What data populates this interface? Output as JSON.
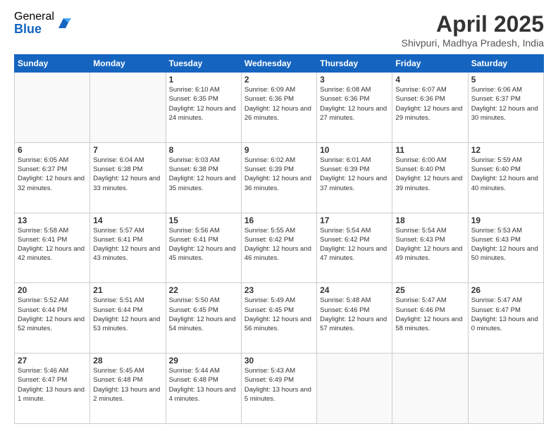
{
  "logo": {
    "general": "General",
    "blue": "Blue"
  },
  "header": {
    "month_year": "April 2025",
    "location": "Shivpuri, Madhya Pradesh, India"
  },
  "weekdays": [
    "Sunday",
    "Monday",
    "Tuesday",
    "Wednesday",
    "Thursday",
    "Friday",
    "Saturday"
  ],
  "weeks": [
    [
      {
        "day": "",
        "empty": true
      },
      {
        "day": "",
        "empty": true
      },
      {
        "day": "1",
        "sunrise": "Sunrise: 6:10 AM",
        "sunset": "Sunset: 6:35 PM",
        "daylight": "Daylight: 12 hours and 24 minutes."
      },
      {
        "day": "2",
        "sunrise": "Sunrise: 6:09 AM",
        "sunset": "Sunset: 6:36 PM",
        "daylight": "Daylight: 12 hours and 26 minutes."
      },
      {
        "day": "3",
        "sunrise": "Sunrise: 6:08 AM",
        "sunset": "Sunset: 6:36 PM",
        "daylight": "Daylight: 12 hours and 27 minutes."
      },
      {
        "day": "4",
        "sunrise": "Sunrise: 6:07 AM",
        "sunset": "Sunset: 6:36 PM",
        "daylight": "Daylight: 12 hours and 29 minutes."
      },
      {
        "day": "5",
        "sunrise": "Sunrise: 6:06 AM",
        "sunset": "Sunset: 6:37 PM",
        "daylight": "Daylight: 12 hours and 30 minutes."
      }
    ],
    [
      {
        "day": "6",
        "sunrise": "Sunrise: 6:05 AM",
        "sunset": "Sunset: 6:37 PM",
        "daylight": "Daylight: 12 hours and 32 minutes."
      },
      {
        "day": "7",
        "sunrise": "Sunrise: 6:04 AM",
        "sunset": "Sunset: 6:38 PM",
        "daylight": "Daylight: 12 hours and 33 minutes."
      },
      {
        "day": "8",
        "sunrise": "Sunrise: 6:03 AM",
        "sunset": "Sunset: 6:38 PM",
        "daylight": "Daylight: 12 hours and 35 minutes."
      },
      {
        "day": "9",
        "sunrise": "Sunrise: 6:02 AM",
        "sunset": "Sunset: 6:39 PM",
        "daylight": "Daylight: 12 hours and 36 minutes."
      },
      {
        "day": "10",
        "sunrise": "Sunrise: 6:01 AM",
        "sunset": "Sunset: 6:39 PM",
        "daylight": "Daylight: 12 hours and 37 minutes."
      },
      {
        "day": "11",
        "sunrise": "Sunrise: 6:00 AM",
        "sunset": "Sunset: 6:40 PM",
        "daylight": "Daylight: 12 hours and 39 minutes."
      },
      {
        "day": "12",
        "sunrise": "Sunrise: 5:59 AM",
        "sunset": "Sunset: 6:40 PM",
        "daylight": "Daylight: 12 hours and 40 minutes."
      }
    ],
    [
      {
        "day": "13",
        "sunrise": "Sunrise: 5:58 AM",
        "sunset": "Sunset: 6:41 PM",
        "daylight": "Daylight: 12 hours and 42 minutes."
      },
      {
        "day": "14",
        "sunrise": "Sunrise: 5:57 AM",
        "sunset": "Sunset: 6:41 PM",
        "daylight": "Daylight: 12 hours and 43 minutes."
      },
      {
        "day": "15",
        "sunrise": "Sunrise: 5:56 AM",
        "sunset": "Sunset: 6:41 PM",
        "daylight": "Daylight: 12 hours and 45 minutes."
      },
      {
        "day": "16",
        "sunrise": "Sunrise: 5:55 AM",
        "sunset": "Sunset: 6:42 PM",
        "daylight": "Daylight: 12 hours and 46 minutes."
      },
      {
        "day": "17",
        "sunrise": "Sunrise: 5:54 AM",
        "sunset": "Sunset: 6:42 PM",
        "daylight": "Daylight: 12 hours and 47 minutes."
      },
      {
        "day": "18",
        "sunrise": "Sunrise: 5:54 AM",
        "sunset": "Sunset: 6:43 PM",
        "daylight": "Daylight: 12 hours and 49 minutes."
      },
      {
        "day": "19",
        "sunrise": "Sunrise: 5:53 AM",
        "sunset": "Sunset: 6:43 PM",
        "daylight": "Daylight: 12 hours and 50 minutes."
      }
    ],
    [
      {
        "day": "20",
        "sunrise": "Sunrise: 5:52 AM",
        "sunset": "Sunset: 6:44 PM",
        "daylight": "Daylight: 12 hours and 52 minutes."
      },
      {
        "day": "21",
        "sunrise": "Sunrise: 5:51 AM",
        "sunset": "Sunset: 6:44 PM",
        "daylight": "Daylight: 12 hours and 53 minutes."
      },
      {
        "day": "22",
        "sunrise": "Sunrise: 5:50 AM",
        "sunset": "Sunset: 6:45 PM",
        "daylight": "Daylight: 12 hours and 54 minutes."
      },
      {
        "day": "23",
        "sunrise": "Sunrise: 5:49 AM",
        "sunset": "Sunset: 6:45 PM",
        "daylight": "Daylight: 12 hours and 56 minutes."
      },
      {
        "day": "24",
        "sunrise": "Sunrise: 5:48 AM",
        "sunset": "Sunset: 6:46 PM",
        "daylight": "Daylight: 12 hours and 57 minutes."
      },
      {
        "day": "25",
        "sunrise": "Sunrise: 5:47 AM",
        "sunset": "Sunset: 6:46 PM",
        "daylight": "Daylight: 12 hours and 58 minutes."
      },
      {
        "day": "26",
        "sunrise": "Sunrise: 5:47 AM",
        "sunset": "Sunset: 6:47 PM",
        "daylight": "Daylight: 13 hours and 0 minutes."
      }
    ],
    [
      {
        "day": "27",
        "sunrise": "Sunrise: 5:46 AM",
        "sunset": "Sunset: 6:47 PM",
        "daylight": "Daylight: 13 hours and 1 minute."
      },
      {
        "day": "28",
        "sunrise": "Sunrise: 5:45 AM",
        "sunset": "Sunset: 6:48 PM",
        "daylight": "Daylight: 13 hours and 2 minutes."
      },
      {
        "day": "29",
        "sunrise": "Sunrise: 5:44 AM",
        "sunset": "Sunset: 6:48 PM",
        "daylight": "Daylight: 13 hours and 4 minutes."
      },
      {
        "day": "30",
        "sunrise": "Sunrise: 5:43 AM",
        "sunset": "Sunset: 6:49 PM",
        "daylight": "Daylight: 13 hours and 5 minutes."
      },
      {
        "day": "",
        "empty": true
      },
      {
        "day": "",
        "empty": true
      },
      {
        "day": "",
        "empty": true
      }
    ]
  ]
}
